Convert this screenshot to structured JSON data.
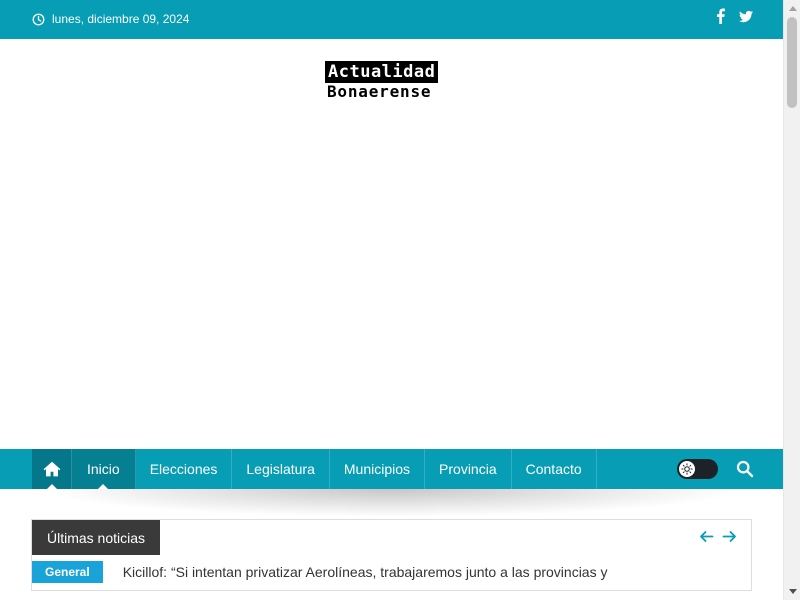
{
  "topbar": {
    "date": "lunes, diciembre 09, 2024",
    "icons": [
      "clock-icon",
      "facebook-icon",
      "twitter-icon"
    ]
  },
  "logo": {
    "line1": "Actualidad",
    "line2": "Bonaerense"
  },
  "nav": {
    "items": [
      {
        "label": "Inicio",
        "active": true
      },
      {
        "label": "Elecciones"
      },
      {
        "label": "Legislatura"
      },
      {
        "label": "Municipios"
      },
      {
        "label": "Provincia"
      },
      {
        "label": "Contacto"
      }
    ],
    "icons": [
      "home-icon",
      "theme-toggle",
      "search-icon"
    ]
  },
  "news": {
    "title": "Últimas noticias",
    "category": "General",
    "headline": "Kicillof: “Si intentan privatizar Aerolíneas, trabajaremos junto a las provincias y",
    "icons": [
      "arrow-left-icon",
      "arrow-right-icon"
    ]
  },
  "colors": {
    "brand": "#069db5",
    "brand_dark": "#04788a",
    "tag_dark": "#3a3a3a",
    "category": "#1aa3d8"
  }
}
